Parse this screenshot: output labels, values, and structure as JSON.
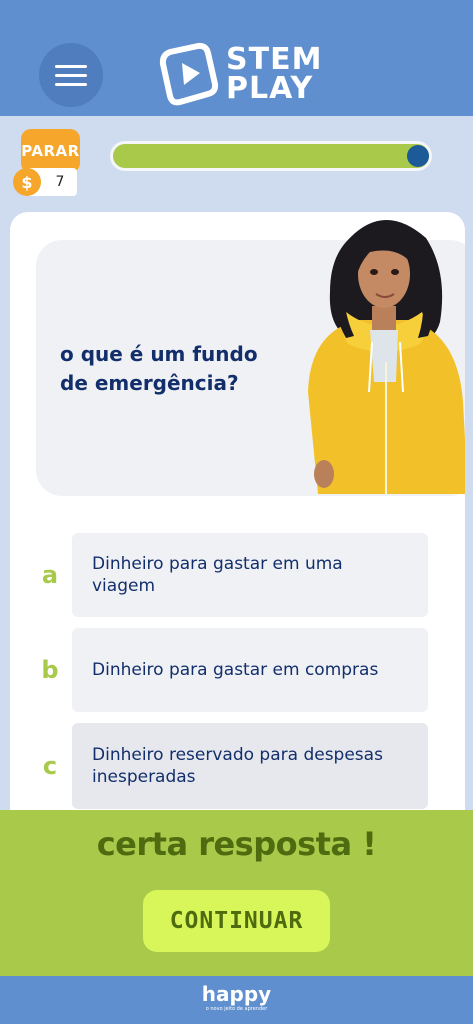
{
  "header": {
    "logo_line1": "STEM",
    "logo_line2": "PLAY",
    "menu_icon": "hamburger-icon",
    "logo_icon": "play-icon"
  },
  "stats": {
    "stop_label": "PARAR",
    "coin_symbol": "$",
    "coins": "7",
    "progress": 1.0
  },
  "question": {
    "text": "o que é um fundo de emergência?"
  },
  "answers": [
    {
      "letter": "a",
      "text": "Dinheiro para gastar em uma viagem"
    },
    {
      "letter": "b",
      "text": "Dinheiro para gastar em compras"
    },
    {
      "letter": "c",
      "text": "Dinheiro reservado para despesas inesperadas"
    }
  ],
  "result": {
    "title": "certa resposta !",
    "continue_label": "CONTINUAR"
  },
  "footer": {
    "logo": "happy",
    "tagline": "o novo jeito de aprender"
  },
  "colors": {
    "header": "#5f8fcf",
    "accent_green": "#a8c94a",
    "button_green": "#d8f55a",
    "text_navy": "#132f6b",
    "stop_orange": "#f6a62b"
  }
}
